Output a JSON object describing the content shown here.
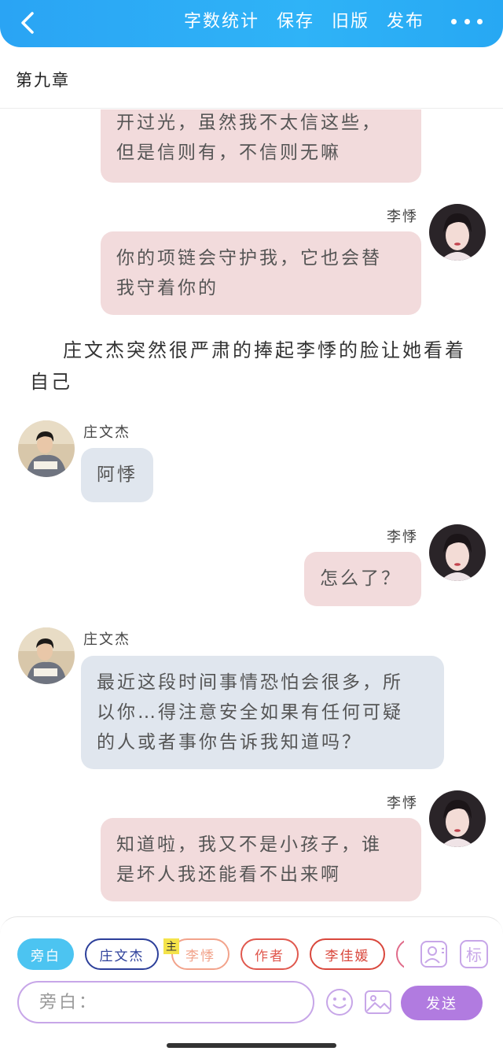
{
  "header": {
    "back_icon": "chevron-left-icon",
    "actions": [
      "字数统计",
      "保存",
      "旧版",
      "发布"
    ],
    "more_icon": "more-dots-icon",
    "color": "#2aa4f4"
  },
  "chapter": {
    "title": "第九章"
  },
  "messages": [
    {
      "role": "right",
      "speaker": "",
      "lines": [
        "开过光，虽然我不太信这些，",
        "但是信则有，不信则无嘛"
      ]
    },
    {
      "role": "right",
      "speaker": "李悸",
      "lines": [
        "你的项链会守护我，它也会替",
        "我守着你的"
      ]
    },
    {
      "role": "narration",
      "text": "庄文杰突然很严肃的捧起李悸的脸让她看着自己"
    },
    {
      "role": "left",
      "speaker": "庄文杰",
      "lines": [
        "阿悸"
      ]
    },
    {
      "role": "right",
      "speaker": "李悸",
      "lines": [
        "怎么了？"
      ]
    },
    {
      "role": "left",
      "speaker": "庄文杰",
      "lines": [
        "最近这段时间事情恐怕会很多，所",
        "以你…得注意安全如果有任何可疑",
        "的人或者事你告诉我知道吗？"
      ]
    },
    {
      "role": "right",
      "speaker": "李悸",
      "lines": [
        "知道啦，我又不是小孩子，谁",
        "是坏人我还能看不出来啊"
      ]
    }
  ],
  "composer": {
    "roles": [
      "旁白",
      "庄文杰",
      "李悸",
      "作者",
      "李佳媛",
      ""
    ],
    "main_badge": "主",
    "icons": [
      "contact-card-icon",
      "tag-icon",
      "emoji-icon",
      "image-icon"
    ],
    "tag_label": "标",
    "input_placeholder": "旁白：",
    "send_label": "发送",
    "send_color": "#b17be0"
  }
}
